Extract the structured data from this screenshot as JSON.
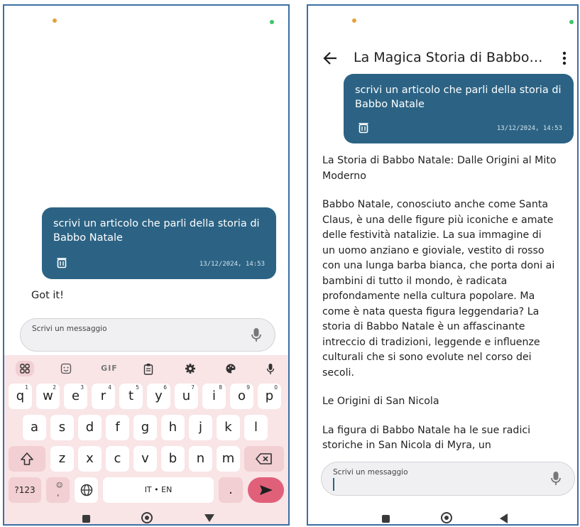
{
  "left": {
    "user_message": "scrivi un articolo che parli della storia di Babbo Natale",
    "timestamp": "13/12/2024, 14:53",
    "bot_reply": "Got it!",
    "input_placeholder": "Scrivi un messaggio",
    "keyboard": {
      "toolbar": [
        "apps-icon",
        "sticker-icon",
        "GIF",
        "clipboard-icon",
        "settings-icon",
        "palette-icon",
        "mic-icon"
      ],
      "gif_label": "GIF",
      "row1": [
        "q",
        "w",
        "e",
        "r",
        "t",
        "y",
        "u",
        "i",
        "o",
        "p"
      ],
      "row1_hints": [
        "1",
        "2",
        "3",
        "4",
        "5",
        "6",
        "7",
        "8",
        "9",
        "0"
      ],
      "row2": [
        "a",
        "s",
        "d",
        "f",
        "g",
        "h",
        "j",
        "k",
        "l"
      ],
      "row3": [
        "z",
        "x",
        "c",
        "v",
        "b",
        "n",
        "m"
      ],
      "symbols_label": "?123",
      "space_label": "IT • EN",
      "period_label": "."
    }
  },
  "right": {
    "title": "La Magica Storia di Babbo…",
    "user_message": "scrivi un articolo che parli della storia di Babbo Natale",
    "timestamp": "13/12/2024, 14:53",
    "article": [
      "La Storia di Babbo Natale: Dalle Origini al Mito Moderno",
      "Babbo Natale, conosciuto anche come Santa Claus, è una delle figure più iconiche e amate delle festività natalizie. La sua immagine di un uomo anziano e gioviale, vestito di rosso con una lunga barba bianca, che porta doni ai bambini di tutto il mondo, è radicata profondamente nella cultura popolare. Ma come è nata questa figura leggendaria? La storia di Babbo Natale è un affascinante intreccio di tradizioni, leggende e influenze culturali che si sono evolute nel corso dei secoli.",
      "Le Origini di San Nicola",
      "La figura di Babbo Natale ha le sue radici storiche in San Nicola di Myra, un"
    ],
    "input_placeholder": "Scrivi un messaggio"
  },
  "colors": {
    "bubble": "#2c6384",
    "keyboard_bg": "#f9e4e6",
    "enter_key": "#e0607a",
    "frame": "#3c6fa3"
  }
}
